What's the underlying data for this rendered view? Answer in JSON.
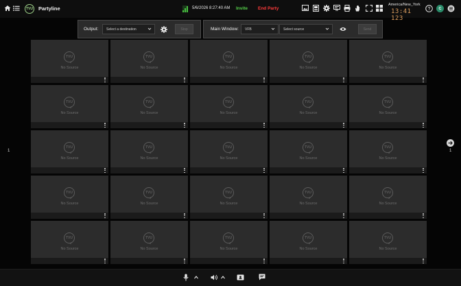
{
  "header": {
    "app_title": "Partyline",
    "logo_text": "TVU",
    "datetime": "5/6/2026 8:27:40 AM",
    "invite_label": "Invite",
    "end_party_label": "End Party",
    "timezone": "America/New_York",
    "clock_time": "13:41 123",
    "avatar_initial": "C",
    "icons": [
      "home-icon",
      "list-icon",
      "signal-icon",
      "image-icon",
      "device-icon",
      "gear-icon",
      "screen-icon",
      "print-icon",
      "hand-icon",
      "fullscreen-icon",
      "grid-icon",
      "help-icon",
      "menu-icon"
    ]
  },
  "output_panel": {
    "label": "Output:",
    "destination_placeholder": "Select a destination",
    "stop_label": "Stop"
  },
  "main_window_panel": {
    "label": "Main Window:",
    "type_value": "VFB",
    "source_placeholder": "Select source",
    "send_label": "Send"
  },
  "grid": {
    "tile_text": "No Source",
    "tile_logo": "TVU",
    "rows": 5,
    "cols": 5
  },
  "pagination": {
    "left_page": "1",
    "right_page": "1"
  },
  "footer": {
    "icons": [
      "microphone-icon",
      "chevron-up-icon",
      "speaker-icon",
      "chevron-up-icon",
      "video-chat-icon",
      "chat-icon"
    ]
  },
  "colors": {
    "accent_green": "#55d04a",
    "danger_red": "#ff3a3a",
    "tile_bg": "#2c2c2c",
    "page_bg": "#050505"
  }
}
